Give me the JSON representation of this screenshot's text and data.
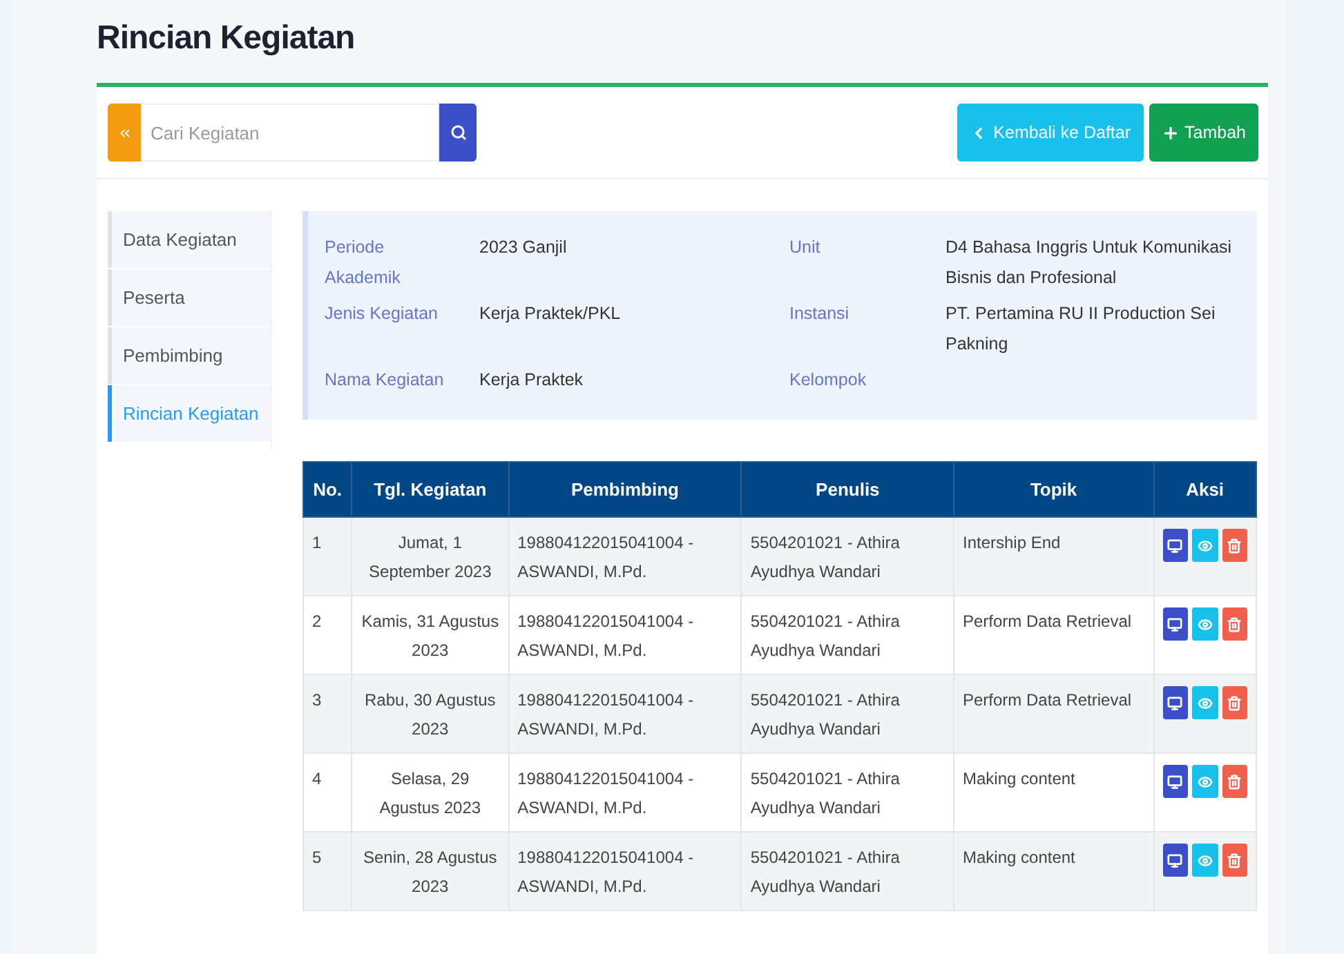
{
  "page_title": "Rincian Kegiatan",
  "search": {
    "placeholder": "Cari Kegiatan"
  },
  "buttons": [
    {
      "kind": "back",
      "label": "Kembali ke Daftar"
    },
    {
      "kind": "add",
      "label": "Tambah"
    }
  ],
  "sidebar": {
    "items": [
      {
        "label": "Data Kegiatan",
        "selected": false
      },
      {
        "label": "Peserta",
        "selected": false
      },
      {
        "label": "Pembimbing",
        "selected": false
      },
      {
        "label": "Rincian Kegiatan",
        "selected": true
      }
    ]
  },
  "info": {
    "left": [
      {
        "label": "Periode Akademik",
        "value": "2023 Ganjil"
      },
      {
        "label": "Jenis Kegiatan",
        "value": "Kerja Praktek/PKL"
      },
      {
        "label": "Nama Kegiatan",
        "value": "Kerja Praktek"
      }
    ],
    "right": [
      {
        "label": "Unit",
        "value": "D4 Bahasa Inggris Untuk Komunikasi Bisnis dan Profesional"
      },
      {
        "label": "Instansi",
        "value": "PT. Pertamina RU II Production Sei Pakning"
      },
      {
        "label": "Kelompok"
      }
    ]
  },
  "table": {
    "columns": [
      "No.",
      "Tgl. Kegiatan",
      "Pembimbing",
      "Penulis",
      "Topik",
      "Aksi"
    ],
    "rows": [
      {
        "no": "1",
        "date": "Jumat, 1 September 2023",
        "pembimbing": "198804122015041004 - ASWANDI, M.Pd.",
        "penulis": "5504201021 - Athira Ayudhya Wandari",
        "topik": "Intership End"
      },
      {
        "no": "2",
        "date": "Kamis, 31 Agustus 2023",
        "pembimbing": "198804122015041004 - ASWANDI, M.Pd.",
        "penulis": "5504201021 - Athira Ayudhya Wandari",
        "topik": "Perform Data Retrieval"
      },
      {
        "no": "3",
        "date": "Rabu, 30 Agustus 2023",
        "pembimbing": "198804122015041004 - ASWANDI, M.Pd.",
        "penulis": "5504201021 - Athira Ayudhya Wandari",
        "topik": "Perform Data Retrieval"
      },
      {
        "no": "4",
        "date": "Selasa, 29 Agustus 2023",
        "pembimbing": "198804122015041004 - ASWANDI, M.Pd.",
        "penulis": "5504201021 - Athira Ayudhya Wandari",
        "topik": "Making content"
      },
      {
        "no": "5",
        "date": "Senin, 28 Agustus 2023",
        "pembimbing": "198804122015041004 - ASWANDI, M.Pd.",
        "penulis": "5504201021 - Athira Ayudhya Wandari",
        "topik": "Making content"
      }
    ]
  }
}
